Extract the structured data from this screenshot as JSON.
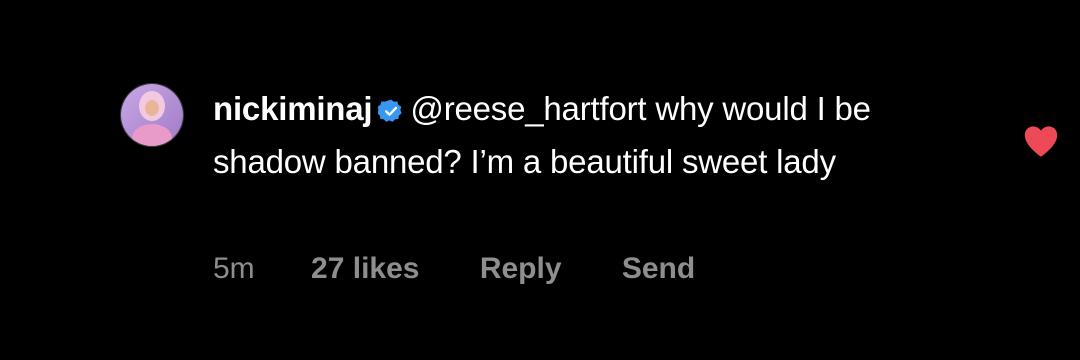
{
  "comment": {
    "username": "nickiminaj",
    "verified_icon": "verified-badge-icon",
    "mention": "@reese_hartfort",
    "text": "why would I be shadow banned? I’m a beautiful sweet lady"
  },
  "meta": {
    "time": "5m",
    "likes": "27 likes",
    "reply_label": "Reply",
    "send_label": "Send"
  },
  "like_button": {
    "icon": "heart-icon",
    "liked": true,
    "color": "#ed4956"
  },
  "colors": {
    "background": "#000000",
    "text": "#ffffff",
    "meta_text": "#8e8e8e",
    "verified": "#3897f0"
  }
}
